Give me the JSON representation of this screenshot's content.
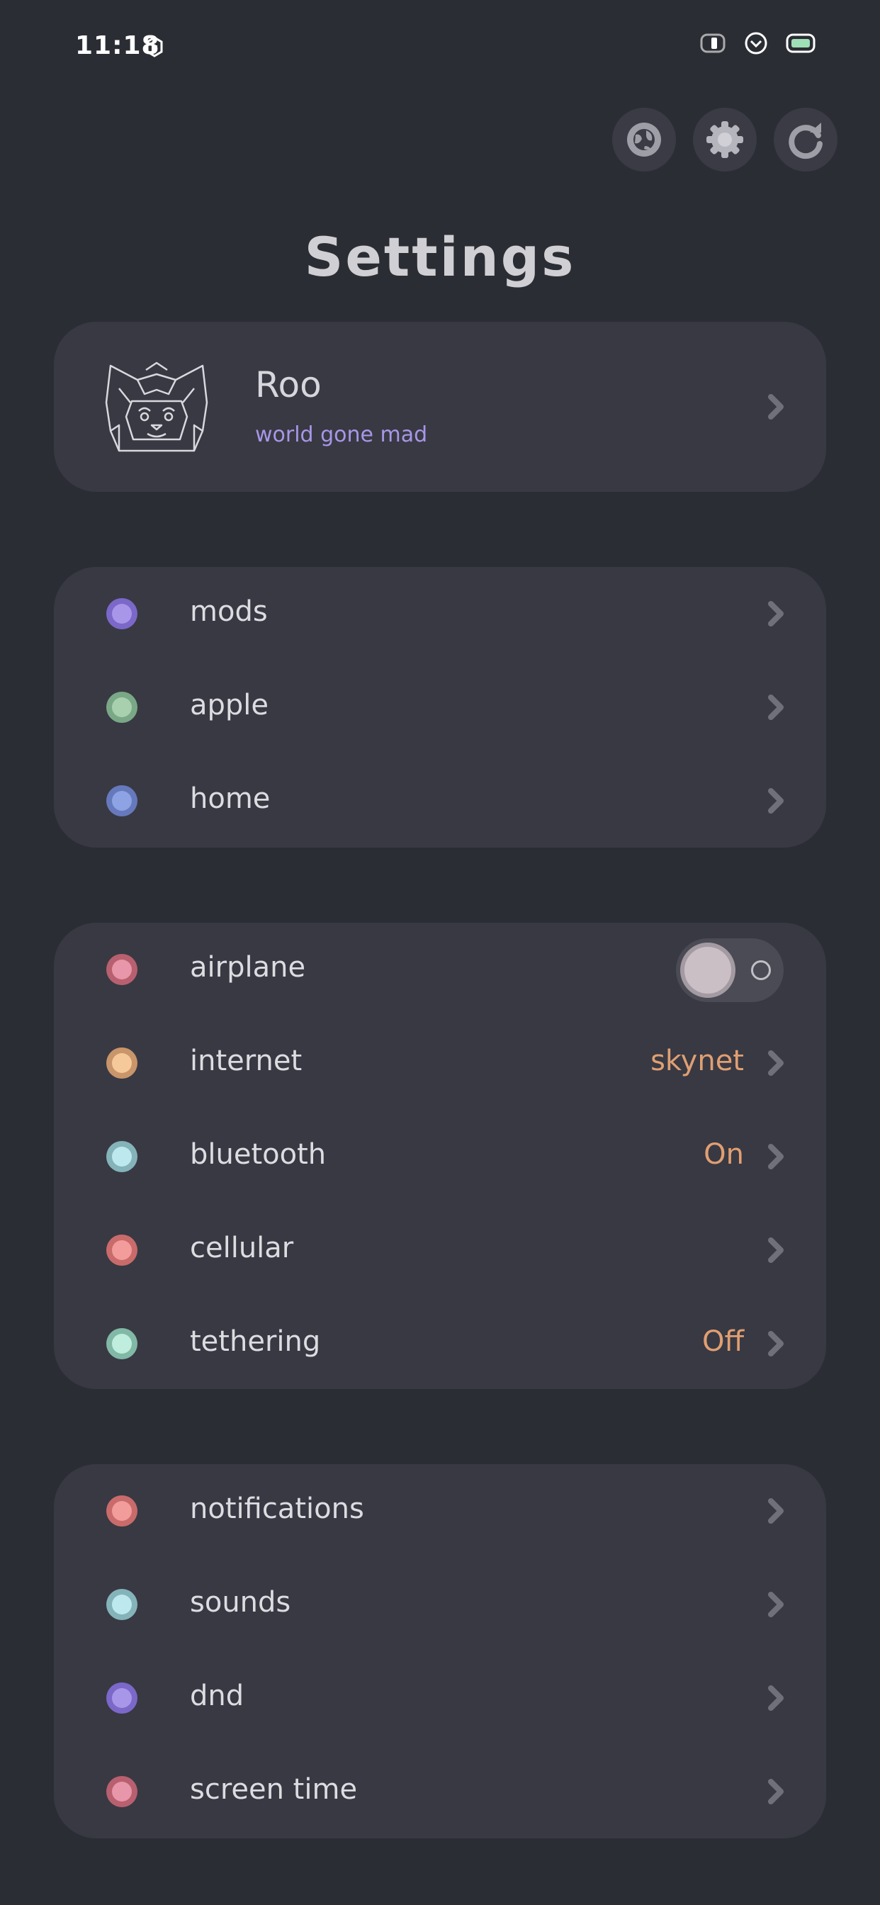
{
  "status_bar": {
    "time": "11:18"
  },
  "title": "Settings",
  "profile": {
    "name": "Roo",
    "subtitle": "world gone mad"
  },
  "groups": [
    {
      "rows": [
        {
          "label": "mods",
          "value": "",
          "color": "#a897e8",
          "ring": "#7b68c8"
        },
        {
          "label": "apple",
          "value": "",
          "color": "#a8d0ae",
          "ring": "#7aa887"
        },
        {
          "label": "home",
          "value": "",
          "color": "#8da3e4",
          "ring": "#6679bd"
        }
      ]
    },
    {
      "rows": [
        {
          "label": "airplane",
          "value": "",
          "toggle": false,
          "color": "#e896aa",
          "ring": "#b8606f"
        },
        {
          "label": "internet",
          "value": "skynet",
          "color": "#f6c99a",
          "ring": "#c9956a"
        },
        {
          "label": "bluetooth",
          "value": "On",
          "color": "#bde9ee",
          "ring": "#84b4ba"
        },
        {
          "label": "cellular",
          "value": "",
          "color": "#f29c9c",
          "ring": "#c96b6b"
        },
        {
          "label": "tethering",
          "value": "Off",
          "color": "#bfeede",
          "ring": "#82b8a6"
        }
      ]
    },
    {
      "rows": [
        {
          "label": "notifications",
          "value": "",
          "color": "#f29c9c",
          "ring": "#c96b6b"
        },
        {
          "label": "sounds",
          "value": "",
          "color": "#bde9ee",
          "ring": "#84b4ba"
        },
        {
          "label": "dnd",
          "value": "",
          "color": "#a897e8",
          "ring": "#7b68c8"
        },
        {
          "label": "screen time",
          "value": "",
          "color": "#e896aa",
          "ring": "#b8606f"
        }
      ]
    }
  ],
  "colors": {
    "background": "#2b2d35",
    "card": "#383943",
    "accent_value": "#e09f72",
    "subtitle": "#a896e6"
  },
  "icons": [
    "globe-icon",
    "gear-icon",
    "refresh-icon",
    "chevron-right-icon",
    "avatar-fox-helmet"
  ]
}
